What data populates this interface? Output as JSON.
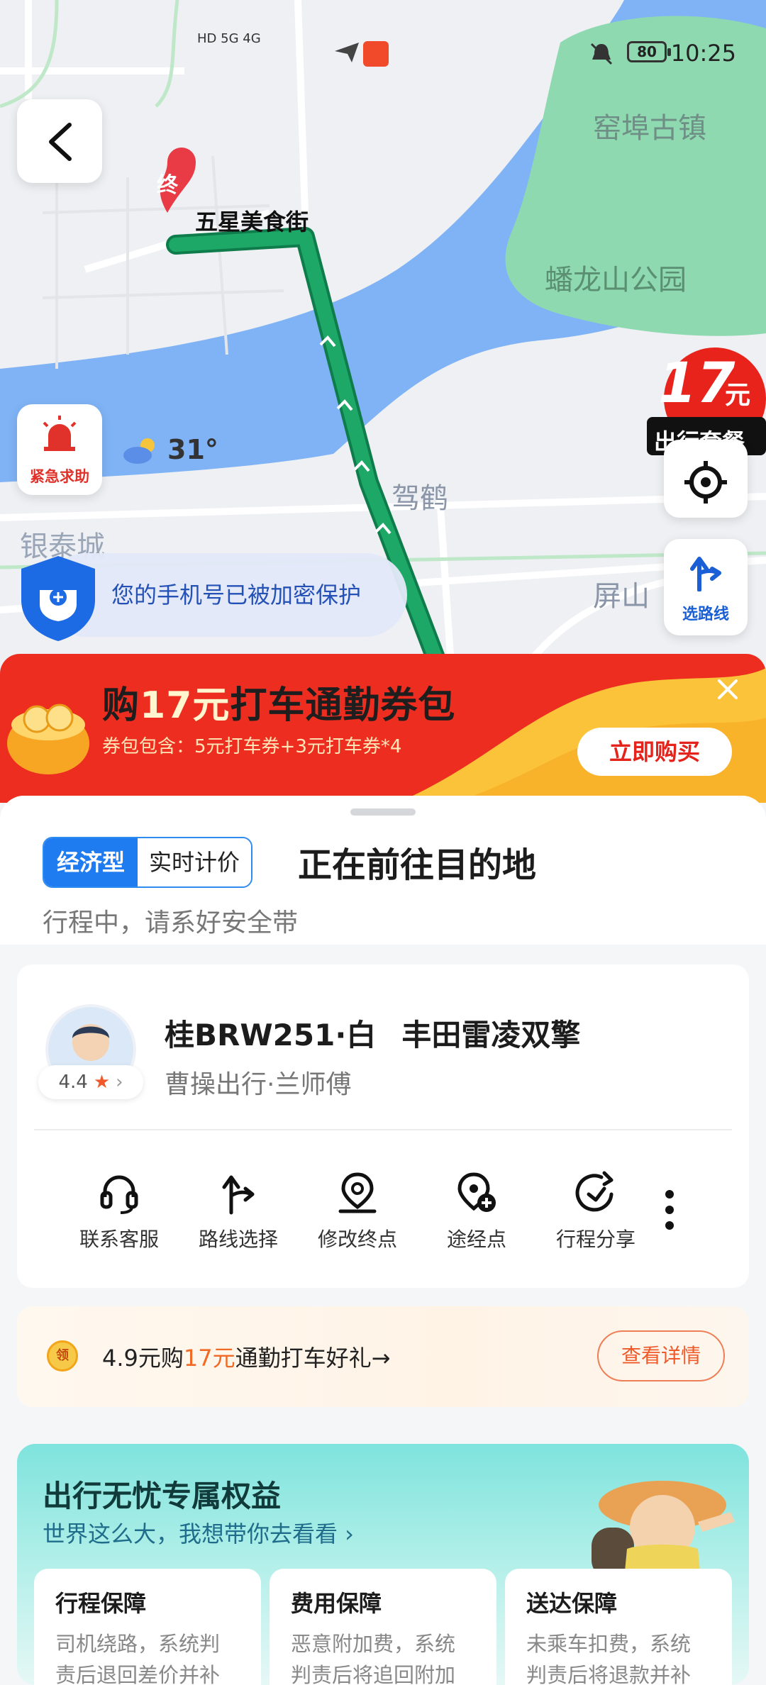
{
  "status_bar": {
    "network": "HD 5G 4G",
    "battery": "80",
    "time": "10:25"
  },
  "map": {
    "labels": {
      "destination_street": "五星美食街",
      "destination_marker": "终",
      "town": "窑埠古镇",
      "park": "蟠龙山公园",
      "district_1": "驾鹤",
      "district_2": "银泰城",
      "district_3": "屏山"
    },
    "weather_temp": "31°",
    "sos_label": "紧急求助",
    "route_label": "选路线",
    "promo_badge": {
      "amount": "17",
      "unit": "元",
      "caption": "出行套餐"
    },
    "privacy_text": "您的手机号已被加密保护"
  },
  "banner": {
    "title_prefix": "购",
    "title_amount": "17元",
    "title_suffix": "打车通勤券包",
    "subtitle": "券包包含：5元打车券+3元打车券*4",
    "buy_label": "立即购买"
  },
  "trip": {
    "tag_type": "经济型",
    "tag_pricing": "实时计价",
    "status": "正在前往目的地",
    "hint": "行程中，请系好安全带"
  },
  "driver": {
    "rating": "4.4",
    "plate": "桂BRW251·白",
    "car_model": "丰田雷凌双擎",
    "company": "曹操出行·兰师傅"
  },
  "actions": [
    {
      "label": "联系客服",
      "icon": "headset-icon"
    },
    {
      "label": "路线选择",
      "icon": "route-fork-icon"
    },
    {
      "label": "修改终点",
      "icon": "location-pin-icon"
    },
    {
      "label": "途经点",
      "icon": "add-waypoint-icon"
    },
    {
      "label": "行程分享",
      "icon": "share-icon"
    }
  ],
  "gift": {
    "coin": "领",
    "text_prefix": "4.9元购",
    "text_amount": "17元",
    "text_suffix": "通勤打车好礼→",
    "button": "查看详情"
  },
  "benefit": {
    "title": "出行无忧专属权益",
    "subtitle": "世界这么大，我想带你去看看 ›",
    "cards": [
      {
        "title": "行程保障",
        "desc": "司机绕路，系统判责后退回差价并补"
      },
      {
        "title": "费用保障",
        "desc": "恶意附加费，系统判责后将追回附加"
      },
      {
        "title": "送达保障",
        "desc": "未乘车扣费，系统判责后将退款并补"
      }
    ]
  },
  "colors": {
    "route": "#1ea867",
    "water": "#7fb3f5",
    "park": "#8ed9b0",
    "banner_red": "#ed2d1f",
    "brand_blue": "#1f7bf0"
  }
}
